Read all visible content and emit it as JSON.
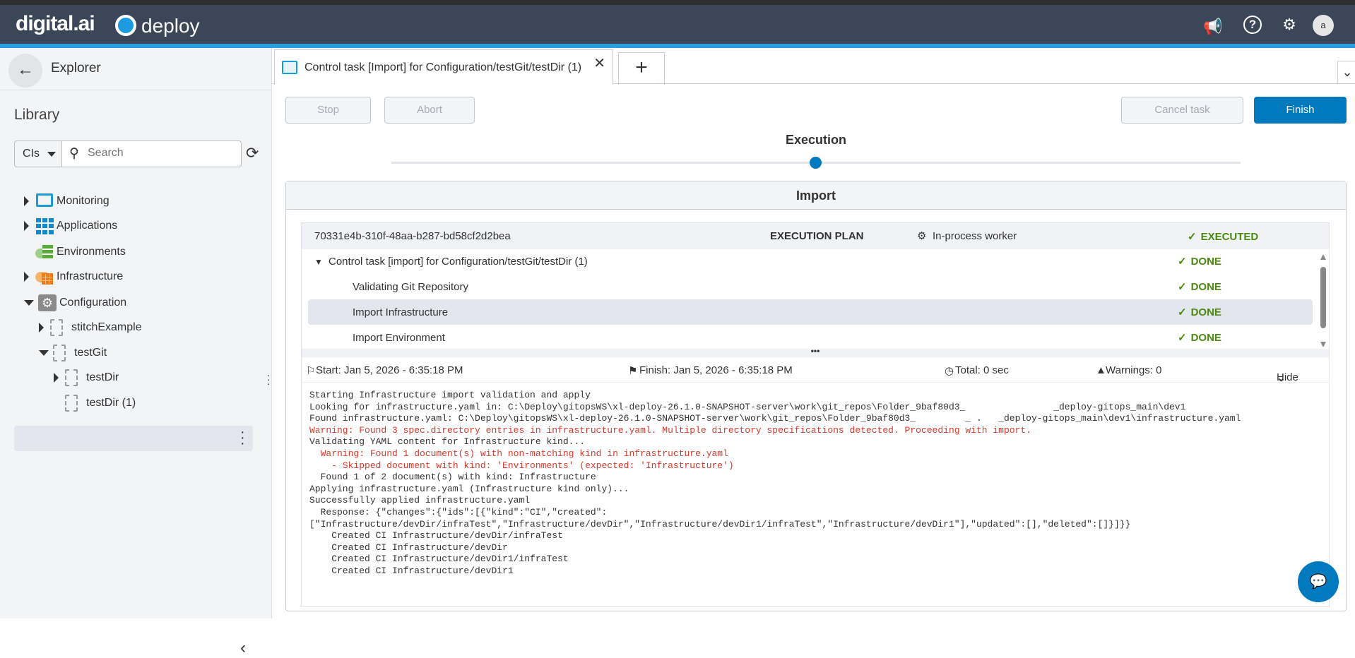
{
  "header": {
    "brand": "digital.ai",
    "product": "deploy",
    "avatar": "a",
    "icons": [
      "megaphone-icon",
      "help-icon",
      "gear-icon"
    ]
  },
  "sidebar": {
    "title": "Explorer",
    "library": "Library",
    "search": {
      "type": "CIs",
      "placeholder": "Search"
    },
    "tree": [
      {
        "label": "Monitoring",
        "level": 0,
        "state": "collapsed",
        "icon": "monitor"
      },
      {
        "label": "Applications",
        "level": 0,
        "state": "collapsed",
        "icon": "grid"
      },
      {
        "label": "Environments",
        "level": 0,
        "state": "leaf",
        "icon": "environments"
      },
      {
        "label": "Infrastructure",
        "level": 0,
        "state": "collapsed",
        "icon": "infrastructure"
      },
      {
        "label": "Configuration",
        "level": 0,
        "state": "expanded",
        "icon": "gear"
      },
      {
        "label": "stitchExample",
        "level": 1,
        "state": "collapsed",
        "icon": "doc"
      },
      {
        "label": "testGit",
        "level": 1,
        "state": "expanded",
        "icon": "doc"
      },
      {
        "label": "testDir",
        "level": 2,
        "state": "collapsed",
        "icon": "doc"
      },
      {
        "label": "testDir (1)",
        "level": 2,
        "state": "leaf",
        "icon": "doc",
        "selected": true
      }
    ]
  },
  "tab": {
    "title": "Control task [Import] for Configuration/testGit/testDir (1)"
  },
  "toolbar": {
    "stop": "Stop",
    "abort": "Abort",
    "cancel": "Cancel task",
    "finish": "Finish"
  },
  "stepper": {
    "label": "Execution"
  },
  "panel": {
    "title": "Import",
    "plan": {
      "id": "70331e4b-310f-48aa-b287-bd58cf2d2bea",
      "heading": "EXECUTION PLAN",
      "worker": "In-process worker",
      "status": "EXECUTED"
    },
    "steps": [
      {
        "label": "Control task [import] for Configuration/testGit/testDir (1)",
        "status": "DONE"
      },
      {
        "label": "Validating Git Repository",
        "status": "DONE"
      },
      {
        "label": "Import Infrastructure",
        "status": "DONE"
      },
      {
        "label": "Import Environment",
        "status": "DONE"
      }
    ],
    "info": {
      "start": "Start: Jan 5, 2026 - 6:35:18 PM",
      "finish": "Finish: Jan 5, 2026 - 6:35:18 PM",
      "total": "Total: 0 sec",
      "warnings": "Warnings: 0",
      "hide": "Hide"
    },
    "log": [
      {
        "t": "Starting Infrastructure import validation and apply",
        "w": false
      },
      {
        "t": "Looking for infrastructure.yaml in: C:\\Deploy\\gitopsWS\\xl-deploy-26.1.0-SNAPSHOT-server\\work\\git_repos\\Folder_9baf80d3_                _deploy-gitops_main\\dev1",
        "w": false
      },
      {
        "t": "Found infrastructure.yaml: C:\\Deploy\\gitopsWS\\xl-deploy-26.1.0-SNAPSHOT-server\\work\\git_repos\\Folder_9baf80d3_         _ .   _deploy-gitops_main\\dev1\\infrastructure.yaml",
        "w": false
      },
      {
        "t": "Warning: Found 3 spec.directory entries in infrastructure.yaml. Multiple directory specifications detected. Proceeding with import.",
        "w": true
      },
      {
        "t": "Validating YAML content for Infrastructure kind...",
        "w": false
      },
      {
        "t": "  Warning: Found 1 document(s) with non-matching kind in infrastructure.yaml",
        "w": true
      },
      {
        "t": "    - Skipped document with kind: 'Environments' (expected: 'Infrastructure')",
        "w": true
      },
      {
        "t": "  Found 1 of 2 document(s) with kind: Infrastructure",
        "w": false
      },
      {
        "t": "Applying infrastructure.yaml (Infrastructure kind only)...",
        "w": false
      },
      {
        "t": "Successfully applied infrastructure.yaml",
        "w": false
      },
      {
        "t": "  Response: {\"changes\":{\"ids\":[{\"kind\":\"CI\",\"created\":",
        "w": false
      },
      {
        "t": "[\"Infrastructure/devDir/infraTest\",\"Infrastructure/devDir\",\"Infrastructure/devDir1/infraTest\",\"Infrastructure/devDir1\"],\"updated\":[],\"deleted\":[]}]}}",
        "w": false
      },
      {
        "t": "    Created CI Infrastructure/devDir/infraTest",
        "w": false
      },
      {
        "t": "    Created CI Infrastructure/devDir",
        "w": false
      },
      {
        "t": "    Created CI Infrastructure/devDir1/infraTest",
        "w": false
      },
      {
        "t": "    Created CI Infrastructure/devDir1",
        "w": false
      }
    ]
  },
  "colors": {
    "header": "#3b4658",
    "accent": "#2a9fe0",
    "primary": "#0079bf",
    "success": "#4b8a0e",
    "warning": "#d9392b"
  }
}
